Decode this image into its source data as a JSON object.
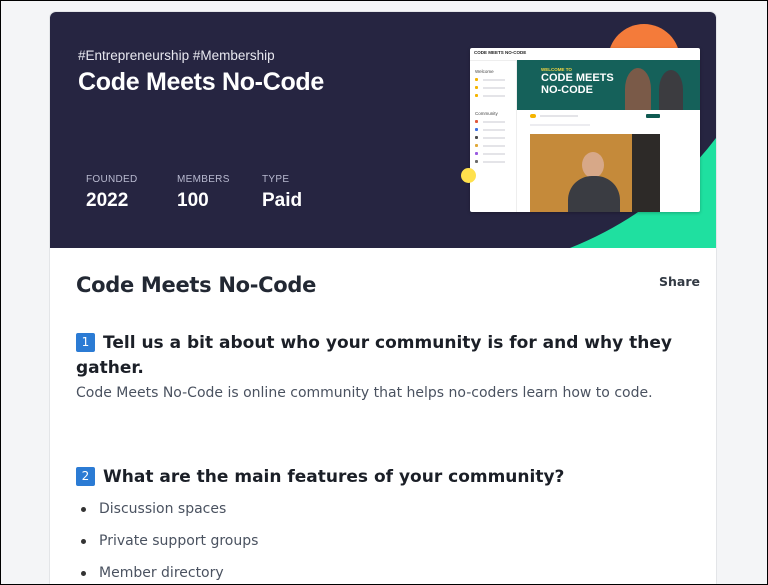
{
  "hero": {
    "hashtags": "#Entrepreneurship #Membership",
    "title": "Code Meets No-Code",
    "stats": [
      {
        "label": "FOUNDED",
        "value": "2022"
      },
      {
        "label": "MEMBERS",
        "value": "100"
      },
      {
        "label": "TYPE",
        "value": "Paid"
      }
    ],
    "preview": {
      "brand": "CODE MEETS NO-CODE",
      "sidebar_welcome": "Welcome",
      "sidebar_community": "Community",
      "banner_small": "WELCOME TO",
      "banner_title_line1": "CODE MEETS",
      "banner_title_line2": "NO-CODE"
    },
    "colors": {
      "background": "#262541",
      "accent_orange": "#f47b3a",
      "accent_green": "#1fe0a0",
      "accent_yellow": "#ffe14d"
    }
  },
  "content": {
    "title": "Code Meets No-Code",
    "share_label": "Share",
    "question1": {
      "number": "1",
      "text": "Tell us a bit about who your community is for and why they gather."
    },
    "answer1": "Code Meets No-Code is online community that helps no-coders learn how to code.",
    "question2": {
      "number": "2",
      "text": "What are the main features of your community?"
    },
    "features": [
      "Discussion spaces",
      "Private support groups",
      "Member directory"
    ]
  }
}
